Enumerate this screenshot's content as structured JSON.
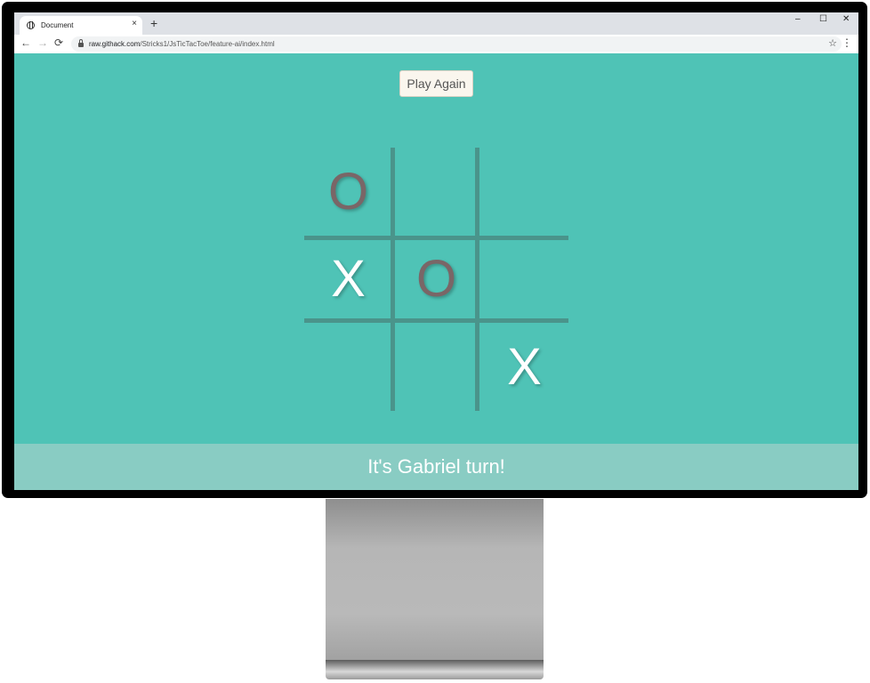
{
  "browser": {
    "tab_title": "Document",
    "tab_close": "×",
    "new_tab": "+",
    "window_minimize": "–",
    "window_maximize": "☐",
    "window_close": "✕",
    "nav_back": "←",
    "nav_forward": "→",
    "nav_reload": "⟳",
    "url_host": "raw.githack.com",
    "url_path": "/Stricks1/JsTicTacToe/feature-ai/index.html",
    "bookmark_star": "☆",
    "menu": "⋮"
  },
  "game": {
    "play_again_label": "Play Again",
    "board": [
      [
        "O",
        "",
        ""
      ],
      [
        "X",
        "O",
        ""
      ],
      [
        "",
        "",
        "X"
      ]
    ],
    "status_text": "It's Gabriel turn!"
  },
  "colors": {
    "background": "#4fc3b6",
    "grid_lines": "#4a948b",
    "mark_o": "#7a6667",
    "mark_x": "#ffffff",
    "status_bar": "#89ccc3"
  }
}
